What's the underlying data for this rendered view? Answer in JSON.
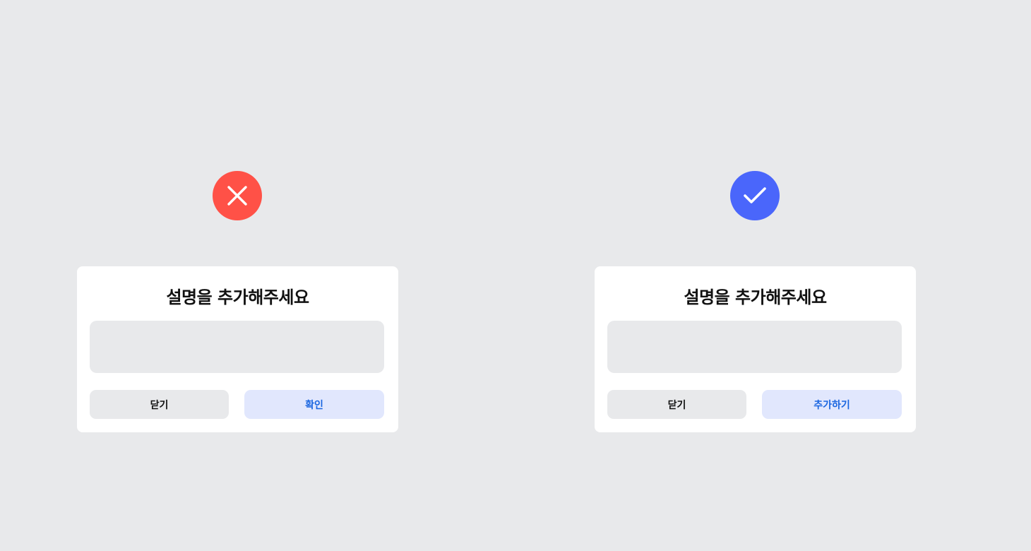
{
  "colors": {
    "background": "#E8E9EB",
    "wrong_icon": "#FF5147",
    "right_icon": "#4A66FB",
    "confirm_text": "#1A66E0",
    "confirm_bg": "#E1E7FD"
  },
  "examples": [
    {
      "status_icon": "close-circle-icon",
      "dialog": {
        "title": "설명을 추가해주세요",
        "input_value": "",
        "close_label": "닫기",
        "confirm_label": "확인"
      }
    },
    {
      "status_icon": "check-circle-icon",
      "dialog": {
        "title": "설명을 추가해주세요",
        "input_value": "",
        "close_label": "닫기",
        "confirm_label": "추가하기"
      }
    }
  ]
}
